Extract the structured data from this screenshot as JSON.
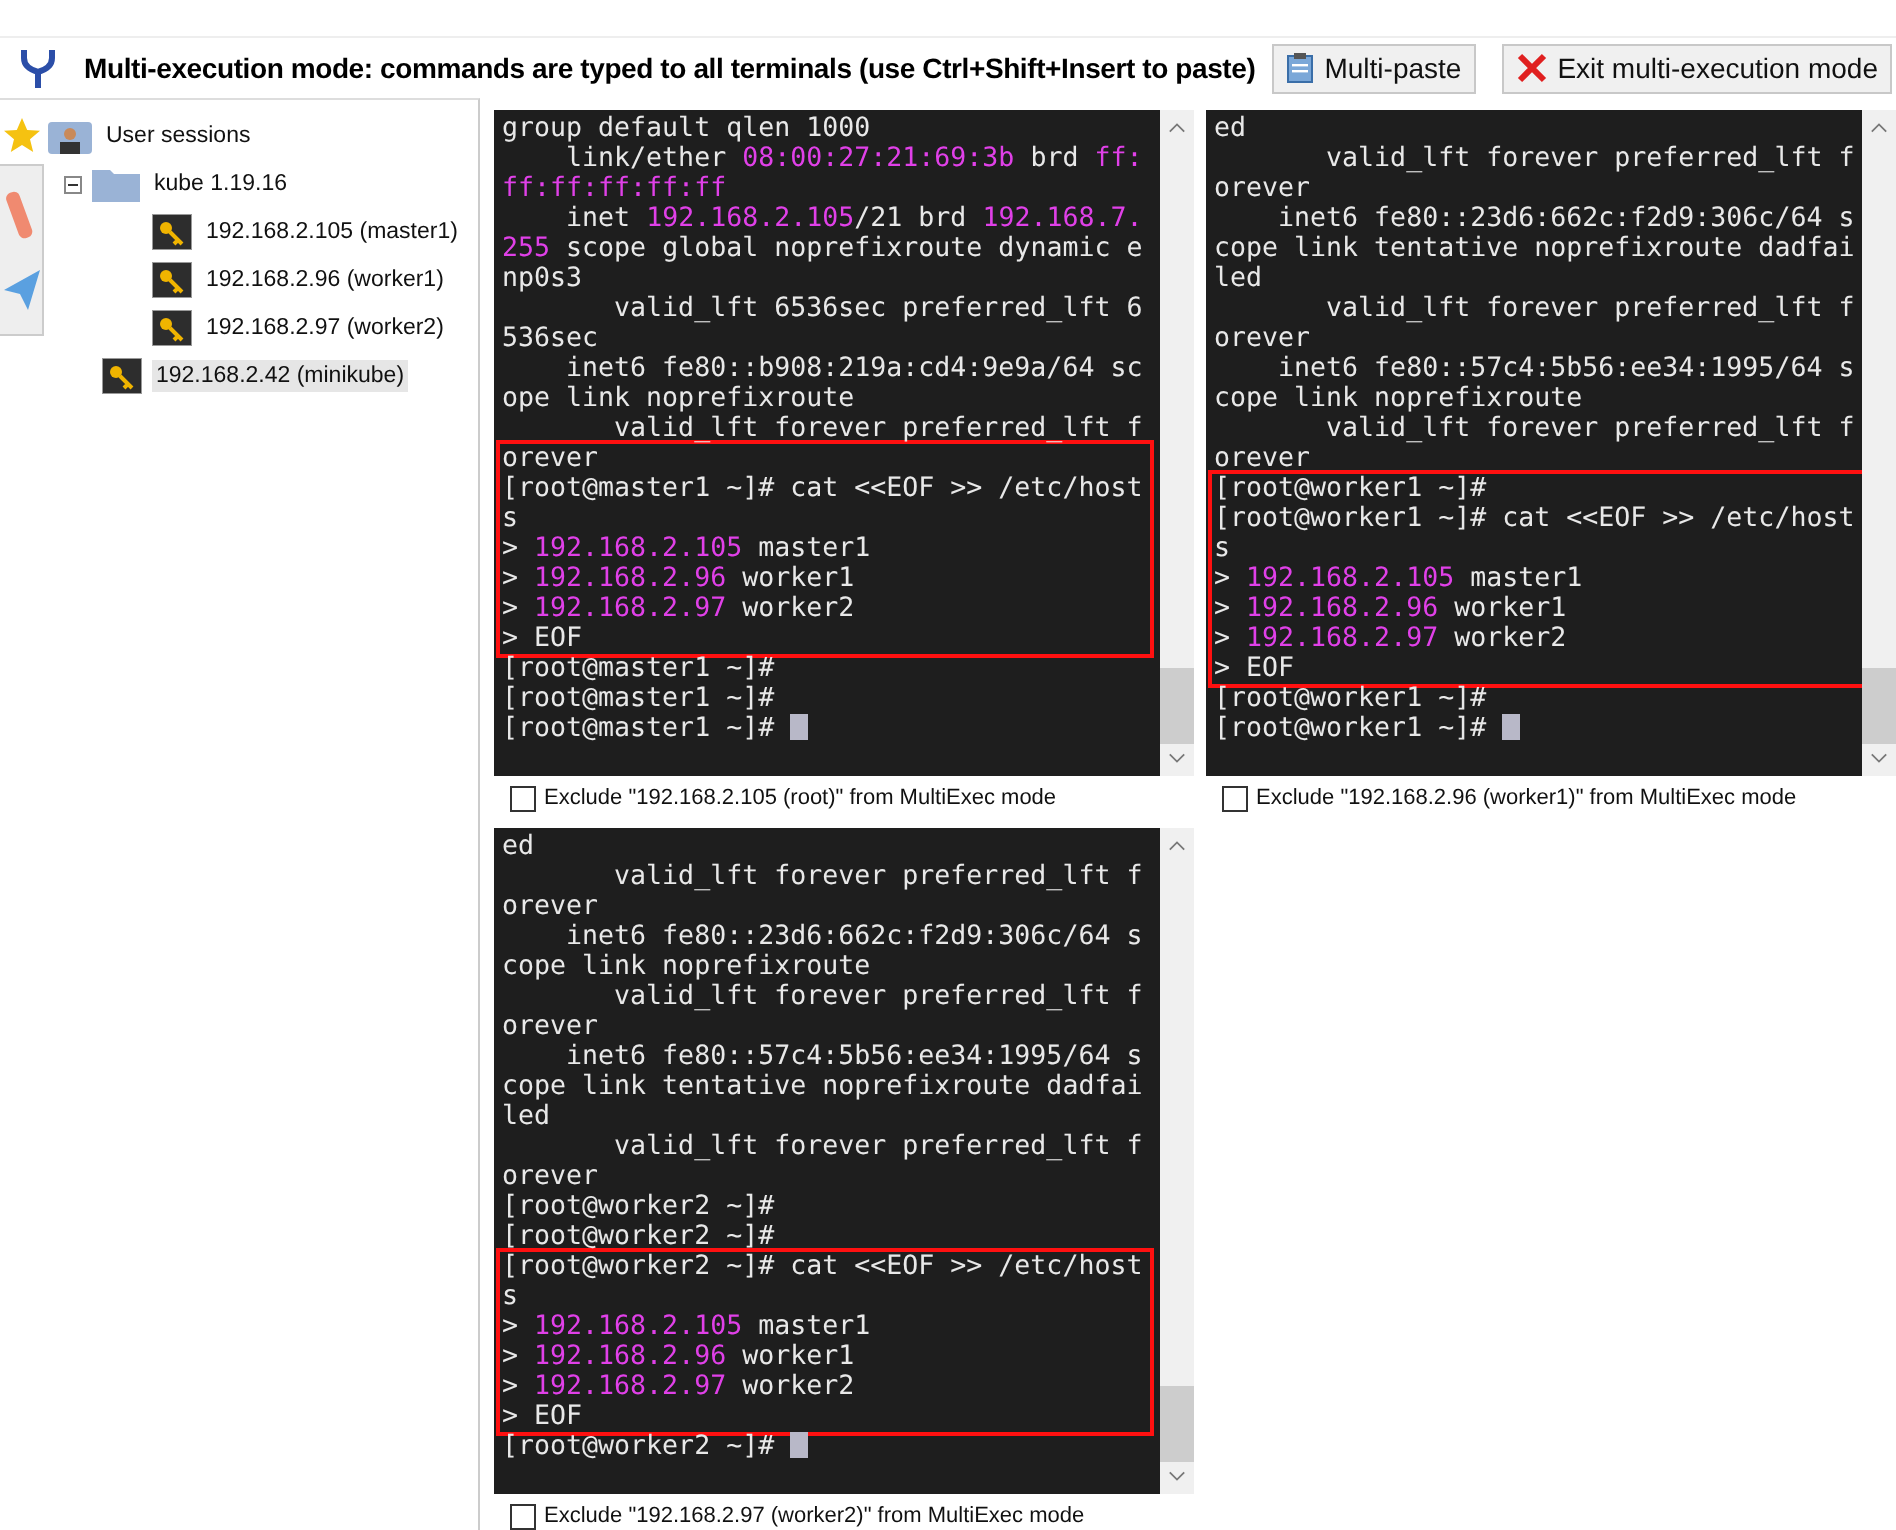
{
  "toolbar": {
    "message": "Multi-execution mode: commands are typed to all terminals (use Ctrl+Shift+Insert to paste)",
    "buttons": [
      {
        "label": "Multi-paste",
        "kind": "paste"
      },
      {
        "label": "Exit multi-execution mode",
        "kind": "exit"
      }
    ]
  },
  "sessions": {
    "label": "User sessions",
    "children": [
      {
        "label": "kube 1.19.16",
        "kind": "folder",
        "expanded": true,
        "children": [
          {
            "label": "192.168.2.105 (master1)",
            "kind": "session",
            "selected": false
          },
          {
            "label": "192.168.2.96 (worker1)",
            "kind": "session",
            "selected": false
          },
          {
            "label": "192.168.2.97 (worker2)",
            "kind": "session",
            "selected": false
          }
        ]
      },
      {
        "label": "192.168.2.42 (minikube)",
        "kind": "session",
        "selected": true
      }
    ]
  },
  "terminals": [
    {
      "exclude": {
        "label": "Exclude \"192.168.2.105 (root)\" from MultiExec mode",
        "checked": false
      },
      "blocks": [
        {
          "marked": false,
          "lines": [
            [
              {
                "text": "group default qlen 1000",
                "highlight": false
              }
            ],
            [
              {
                "text": "    link/ether ",
                "highlight": false
              },
              {
                "text": "08:00:27:21:69:3b",
                "highlight": true
              },
              {
                "text": " brd ",
                "highlight": false
              },
              {
                "text": "ff:",
                "highlight": true
              }
            ],
            [
              {
                "text": "ff:ff:ff:ff:ff",
                "highlight": true
              }
            ],
            [
              {
                "text": "    inet ",
                "highlight": false
              },
              {
                "text": "192.168.2.105",
                "highlight": true
              },
              {
                "text": "/21 brd ",
                "highlight": false
              },
              {
                "text": "192.168.7.",
                "highlight": true
              }
            ],
            [
              {
                "text": "255",
                "highlight": true
              },
              {
                "text": " scope global noprefixroute dynamic e",
                "highlight": false
              }
            ],
            [
              {
                "text": "np0s3",
                "highlight": false
              }
            ],
            [
              {
                "text": "       valid_lft 6536sec preferred_lft 6",
                "highlight": false
              }
            ],
            [
              {
                "text": "536sec",
                "highlight": false
              }
            ],
            [
              {
                "text": "    inet6 fe80::b908:219a:cd4:9e9a/64 sc",
                "highlight": false
              }
            ],
            [
              {
                "text": "ope link noprefixroute",
                "highlight": false
              }
            ],
            [
              {
                "text": "       valid_lft forever preferred_lft f",
                "highlight": false
              }
            ]
          ]
        },
        {
          "marked": true,
          "lines": [
            [
              {
                "text": "orever",
                "highlight": false
              }
            ],
            [
              {
                "text": "[root@master1 ~]# cat <<EOF >> /etc/host",
                "highlight": false
              }
            ],
            [
              {
                "text": "s",
                "highlight": false
              }
            ],
            [
              {
                "text": "> ",
                "highlight": false
              },
              {
                "text": "192.168.2.105",
                "highlight": true
              },
              {
                "text": " master1",
                "highlight": false
              }
            ],
            [
              {
                "text": "> ",
                "highlight": false
              },
              {
                "text": "192.168.2.96",
                "highlight": true
              },
              {
                "text": " worker1",
                "highlight": false
              }
            ],
            [
              {
                "text": "> ",
                "highlight": false
              },
              {
                "text": "192.168.2.97",
                "highlight": true
              },
              {
                "text": " worker2",
                "highlight": false
              }
            ],
            [
              {
                "text": "> EOF",
                "highlight": false
              }
            ]
          ]
        },
        {
          "marked": false,
          "lines": [
            [
              {
                "text": "[root@master1 ~]#",
                "highlight": false
              }
            ],
            [
              {
                "text": "[root@master1 ~]#",
                "highlight": false
              }
            ],
            [
              {
                "text": "[root@master1 ~]# ",
                "highlight": false
              }
            ]
          ]
        }
      ]
    },
    {
      "exclude": {
        "label": "Exclude \"192.168.2.96 (worker1)\" from MultiExec mode",
        "checked": false
      },
      "blocks": [
        {
          "marked": false,
          "lines": [
            [
              {
                "text": "ed",
                "highlight": false
              }
            ],
            [
              {
                "text": "       valid_lft forever preferred_lft f",
                "highlight": false
              }
            ],
            [
              {
                "text": "orever",
                "highlight": false
              }
            ],
            [
              {
                "text": "    inet6 fe80::23d6:662c:f2d9:306c/64 s",
                "highlight": false
              }
            ],
            [
              {
                "text": "cope link tentative noprefixroute dadfai",
                "highlight": false
              }
            ],
            [
              {
                "text": "led",
                "highlight": false
              }
            ],
            [
              {
                "text": "       valid_lft forever preferred_lft f",
                "highlight": false
              }
            ],
            [
              {
                "text": "orever",
                "highlight": false
              }
            ],
            [
              {
                "text": "    inet6 fe80::57c4:5b56:ee34:1995/64 s",
                "highlight": false
              }
            ],
            [
              {
                "text": "cope link noprefixroute",
                "highlight": false
              }
            ],
            [
              {
                "text": "       valid_lft forever preferred_lft f",
                "highlight": false
              }
            ],
            [
              {
                "text": "orever",
                "highlight": false
              }
            ]
          ]
        },
        {
          "marked": true,
          "lines": [
            [
              {
                "text": "[root@worker1 ~]#",
                "highlight": false
              }
            ],
            [
              {
                "text": "[root@worker1 ~]# cat <<EOF >> /etc/host",
                "highlight": false
              }
            ],
            [
              {
                "text": "s",
                "highlight": false
              }
            ],
            [
              {
                "text": "> ",
                "highlight": false
              },
              {
                "text": "192.168.2.105",
                "highlight": true
              },
              {
                "text": " master1",
                "highlight": false
              }
            ],
            [
              {
                "text": "> ",
                "highlight": false
              },
              {
                "text": "192.168.2.96",
                "highlight": true
              },
              {
                "text": " worker1",
                "highlight": false
              }
            ],
            [
              {
                "text": "> ",
                "highlight": false
              },
              {
                "text": "192.168.2.97",
                "highlight": true
              },
              {
                "text": " worker2",
                "highlight": false
              }
            ],
            [
              {
                "text": "> EOF",
                "highlight": false
              }
            ]
          ]
        },
        {
          "marked": false,
          "lines": [
            [
              {
                "text": "[root@worker1 ~]#",
                "highlight": false
              }
            ],
            [
              {
                "text": "[root@worker1 ~]# ",
                "highlight": false
              }
            ]
          ]
        }
      ]
    },
    {
      "exclude": {
        "label": "Exclude \"192.168.2.97 (worker2)\" from MultiExec mode",
        "checked": false
      },
      "blocks": [
        {
          "marked": false,
          "lines": [
            [
              {
                "text": "ed",
                "highlight": false
              }
            ],
            [
              {
                "text": "       valid_lft forever preferred_lft f",
                "highlight": false
              }
            ],
            [
              {
                "text": "orever",
                "highlight": false
              }
            ],
            [
              {
                "text": "    inet6 fe80::23d6:662c:f2d9:306c/64 s",
                "highlight": false
              }
            ],
            [
              {
                "text": "cope link noprefixroute",
                "highlight": false
              }
            ],
            [
              {
                "text": "       valid_lft forever preferred_lft f",
                "highlight": false
              }
            ],
            [
              {
                "text": "orever",
                "highlight": false
              }
            ],
            [
              {
                "text": "    inet6 fe80::57c4:5b56:ee34:1995/64 s",
                "highlight": false
              }
            ],
            [
              {
                "text": "cope link tentative noprefixroute dadfai",
                "highlight": false
              }
            ],
            [
              {
                "text": "led",
                "highlight": false
              }
            ],
            [
              {
                "text": "       valid_lft forever preferred_lft f",
                "highlight": false
              }
            ],
            [
              {
                "text": "orever",
                "highlight": false
              }
            ],
            [
              {
                "text": "[root@worker2 ~]#",
                "highlight": false
              }
            ],
            [
              {
                "text": "[root@worker2 ~]#",
                "highlight": false
              }
            ]
          ]
        },
        {
          "marked": true,
          "lines": [
            [
              {
                "text": "[root@worker2 ~]# cat <<EOF >> /etc/host",
                "highlight": false
              }
            ],
            [
              {
                "text": "s",
                "highlight": false
              }
            ],
            [
              {
                "text": "> ",
                "highlight": false
              },
              {
                "text": "192.168.2.105",
                "highlight": true
              },
              {
                "text": " master1",
                "highlight": false
              }
            ],
            [
              {
                "text": "> ",
                "highlight": false
              },
              {
                "text": "192.168.2.96",
                "highlight": true
              },
              {
                "text": " worker1",
                "highlight": false
              }
            ],
            [
              {
                "text": "> ",
                "highlight": false
              },
              {
                "text": "192.168.2.97",
                "highlight": true
              },
              {
                "text": " worker2",
                "highlight": false
              }
            ],
            [
              {
                "text": "> EOF",
                "highlight": false
              }
            ]
          ]
        },
        {
          "marked": false,
          "lines": [
            [
              {
                "text": "[root@worker2 ~]# ",
                "highlight": false
              }
            ]
          ]
        }
      ]
    }
  ]
}
